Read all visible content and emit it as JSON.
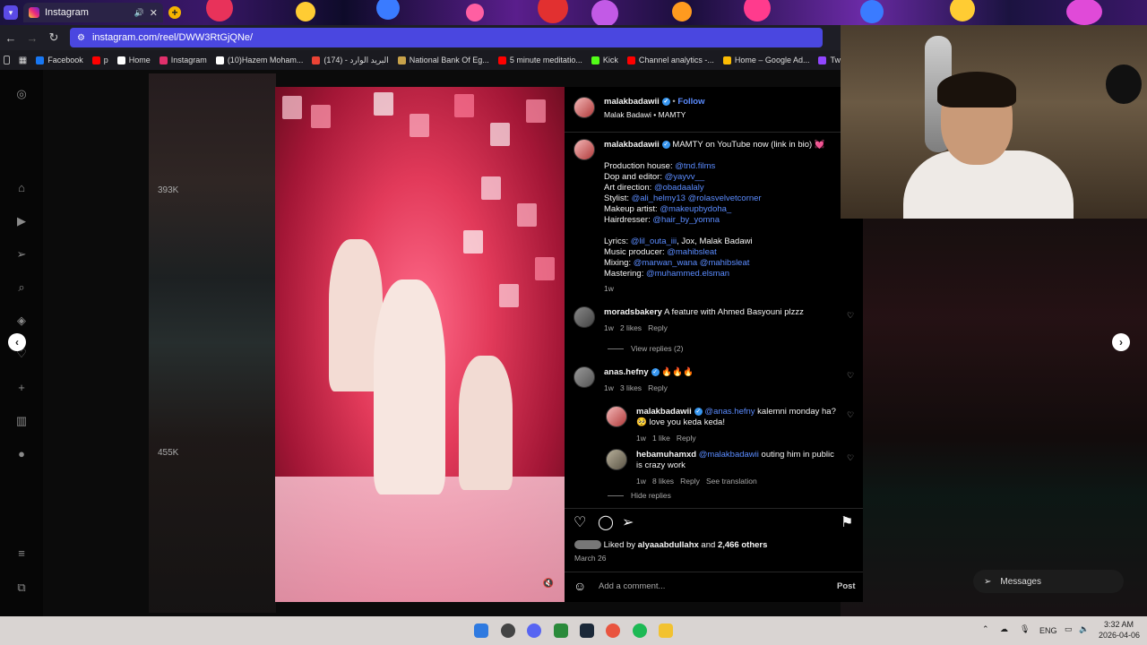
{
  "browser": {
    "tab_title": "Instagram",
    "url": "instagram.com/reel/DWW3RtGjQNe/",
    "bookmarks": [
      {
        "label": "Facebook",
        "color": "#1877f2"
      },
      {
        "label": "p",
        "color": "#ff0000"
      },
      {
        "label": "Home",
        "color": "#ffffff"
      },
      {
        "label": "Instagram",
        "color": "#e1306c"
      },
      {
        "label": "(10)Hazem Moham...",
        "color": "#ffffff"
      },
      {
        "label": "(174) - البريد الوارد",
        "color": "#ea4335"
      },
      {
        "label": "National Bank Of Eg...",
        "color": "#c8a24a"
      },
      {
        "label": "5 minute meditatio...",
        "color": "#ff0000"
      },
      {
        "label": "Kick",
        "color": "#53fc18"
      },
      {
        "label": "Channel analytics -...",
        "color": "#ff0000"
      },
      {
        "label": "Home – Google Ad...",
        "color": "#fbbc04"
      },
      {
        "label": "Tw",
        "color": "#9146ff"
      }
    ]
  },
  "background": {
    "left_views_top": "393K",
    "left_views_bottom": "455K"
  },
  "post": {
    "author": "malakbadawii",
    "follow": "Follow",
    "subtitle": "Malak Badawi • MAMTY",
    "caption": {
      "author": "malakbadawii",
      "text": "MAMTY on YouTube now (link in bio) 💓",
      "lines": [
        {
          "label": "Production house: ",
          "link": "@tnd.films"
        },
        {
          "label": "Dop and editor: ",
          "link": "@yayvv__"
        },
        {
          "label": "Art direction: ",
          "link": "@obadaalaly"
        },
        {
          "label": "Stylist: ",
          "link": "@ali_helmy13 @rolasvelvetcorner"
        },
        {
          "label": "Makeup artist: ",
          "link": "@makeupbydoha_"
        },
        {
          "label": "Hairdresser: ",
          "link": "@hair_by_yomna"
        }
      ],
      "lines2": [
        {
          "label": "Lyrics: ",
          "link": "@lil_outa_iii",
          "suffix": ", Jox, Malak Badawi"
        },
        {
          "label": "Music producer: ",
          "link": "@mahibsleat",
          "suffix": ""
        },
        {
          "label": "Mixing: ",
          "link": "@marwan_wana @mahibsleat",
          "suffix": ""
        },
        {
          "label": "Mastering: ",
          "link": "@muhammed.elsman",
          "suffix": ""
        }
      ],
      "time": "1w"
    },
    "comments": [
      {
        "user": "moradsbakery",
        "text": "A feature with Ahmed Basyouni plzzz",
        "time": "1w",
        "likes": "2 likes",
        "reply": "Reply",
        "view_replies": "View replies (2)"
      },
      {
        "user": "anas.hefny",
        "text": "🔥🔥🔥",
        "time": "1w",
        "likes": "3 likes",
        "reply": "Reply"
      }
    ],
    "replies": [
      {
        "user": "malakbadawii",
        "mention": "@anas.hefny",
        "text": " kalemni monday ha?",
        "text2": "🥺 love you keda keda!",
        "time": "1w",
        "likes": "1 like",
        "reply": "Reply"
      },
      {
        "user": "hebamuhamxd",
        "mention": "@malakbadawii",
        "text": " outing him in public",
        "text2": "is crazy work",
        "time": "1w",
        "likes": "8 likes",
        "reply": "Reply",
        "translate": "See translation"
      }
    ],
    "hide_replies": "Hide replies",
    "liked_by_prefix": "Liked by ",
    "liked_by_user": "alyaaabdullahx",
    "liked_by_and": " and ",
    "liked_by_others": "2,466 others",
    "date": "March 26",
    "comment_placeholder": "Add a comment...",
    "post_button": "Post"
  },
  "messages_label": "Messages",
  "taskbar": {
    "lang": "ENG",
    "time": "3:32 AM",
    "date": "2026-04-06"
  }
}
